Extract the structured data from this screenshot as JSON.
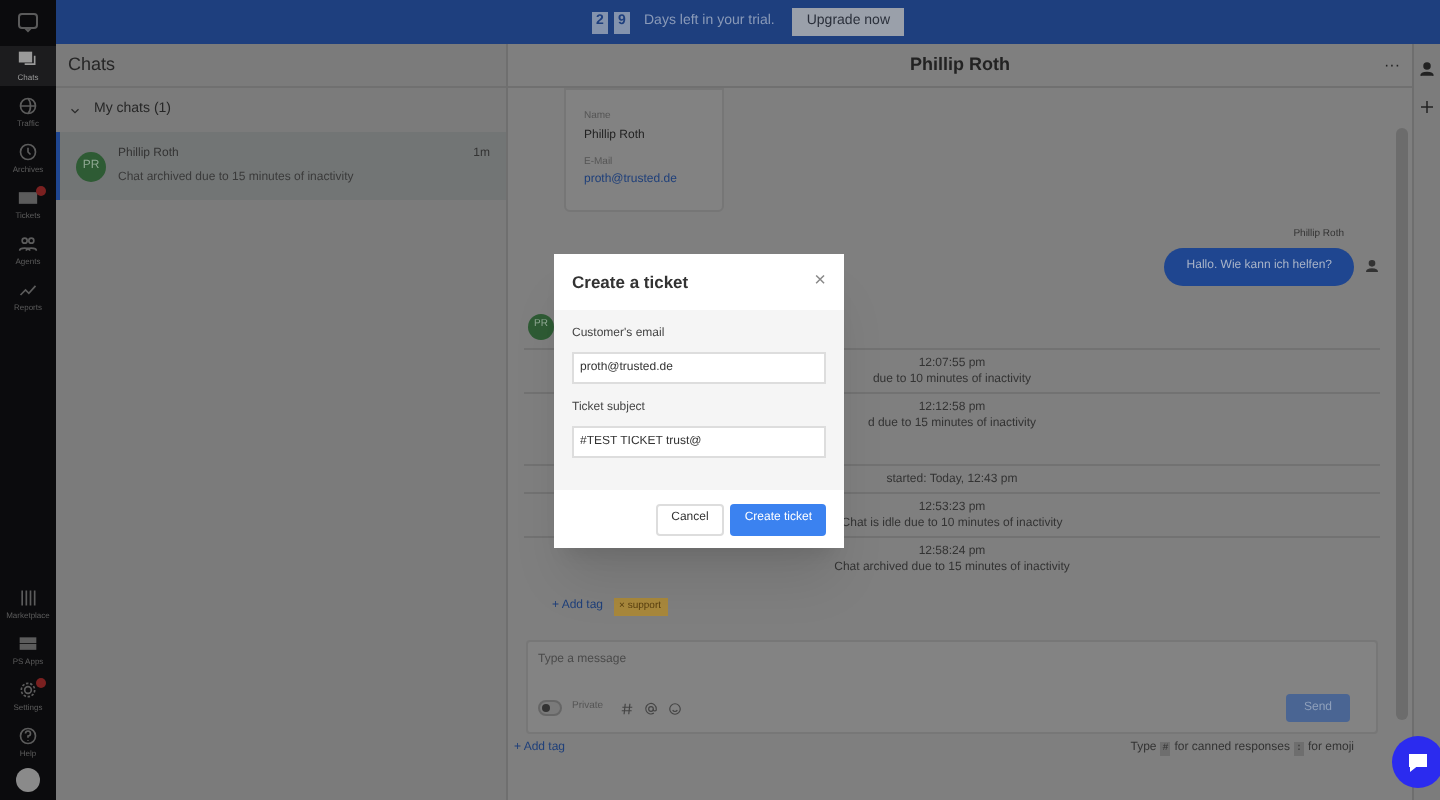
{
  "banner": {
    "digits": [
      "2",
      "9"
    ],
    "text": "Days left in your trial.",
    "button": "Upgrade now"
  },
  "nav": {
    "top": [
      {
        "label": "Chats",
        "selected": true,
        "badge": false
      },
      {
        "label": "Traffic",
        "selected": false,
        "badge": false
      },
      {
        "label": "Archives",
        "selected": false,
        "badge": false
      },
      {
        "label": "Tickets",
        "selected": false,
        "badge": true
      },
      {
        "label": "Agents",
        "selected": false,
        "badge": false
      },
      {
        "label": "Reports",
        "selected": false,
        "badge": false
      }
    ],
    "bottom": [
      {
        "label": "Marketplace",
        "selected": false,
        "badge": false
      },
      {
        "label": "PS Apps",
        "selected": false,
        "badge": false
      },
      {
        "label": "Settings",
        "selected": false,
        "badge": true
      },
      {
        "label": "Help",
        "selected": false,
        "badge": false
      }
    ]
  },
  "chat_list": {
    "title": "Chats",
    "group": {
      "label": "My chats (1)",
      "expanded": true
    },
    "items": [
      {
        "initials": "PR",
        "name": "Phillip Roth",
        "time": "1m",
        "preview": "Chat archived due to 15 minutes of inactivity",
        "selected": true
      }
    ]
  },
  "conversation": {
    "title": "Phillip Roth",
    "menu": "···",
    "card": {
      "name_label": "Name",
      "name": "Phillip Roth",
      "email_label": "E-Mail",
      "email": "proth@trusted.de"
    },
    "message": {
      "sender": "Phillip Roth",
      "text": "Hallo. Wie kann ich helfen?"
    },
    "avatar": "PR",
    "events": [
      {
        "time": "12:07:55 pm",
        "text": "due to 10 minutes of inactivity"
      },
      {
        "time": "12:12:58 pm",
        "text": "d due to 15 minutes of inactivity"
      },
      {
        "text": "started: Today, 12:43 pm"
      },
      {
        "time": "12:53:23 pm",
        "text": "Chat is idle due to 10 minutes of inactivity"
      },
      {
        "time": "12:58:24 pm",
        "text": "Chat archived due to 15 minutes of inactivity"
      }
    ],
    "add_tag": "+ Add tag",
    "tag": "× support",
    "composer": {
      "placeholder": "Type a message",
      "private": "Private",
      "private_on": false,
      "send": "Send"
    },
    "footer_add_tag": "+ Add tag",
    "hint": [
      "Type",
      "#",
      "for canned responses",
      ":",
      "for emoji"
    ]
  },
  "modal": {
    "title": "Create a ticket",
    "close": "×",
    "fields": [
      {
        "label": "Customer's email",
        "value": "proth@trusted.de"
      },
      {
        "label": "Ticket subject",
        "value": "#TEST TICKET trust@"
      }
    ],
    "cancel": "Cancel",
    "submit": "Create ticket"
  }
}
